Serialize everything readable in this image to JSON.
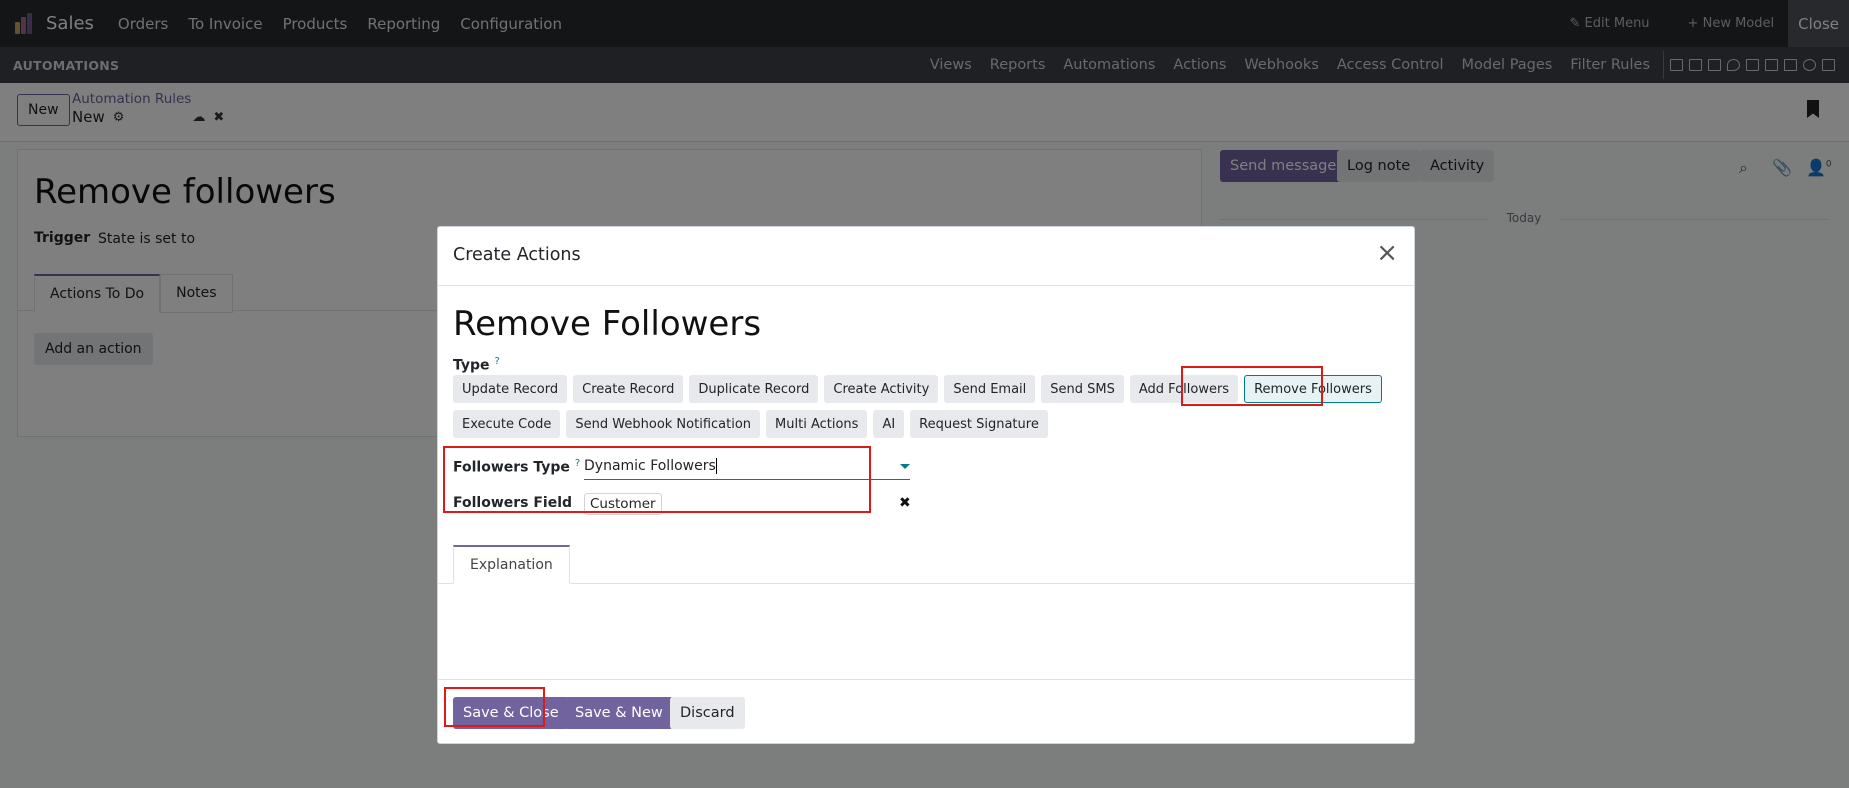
{
  "topbar": {
    "app_name": "Sales",
    "menu": [
      "Orders",
      "To Invoice",
      "Products",
      "Reporting",
      "Configuration"
    ],
    "edit_menu": "Edit Menu",
    "new_model": "New Model",
    "close": "Close"
  },
  "subbar": {
    "brand": "AUTOMATIONS",
    "items": [
      "Views",
      "Reports",
      "Automations",
      "Actions",
      "Webhooks",
      "Access Control",
      "Model Pages",
      "Filter Rules"
    ]
  },
  "control": {
    "new_button": "New",
    "breadcrumb": "Automation Rules",
    "record_name": "New"
  },
  "form": {
    "title": "Remove followers",
    "trigger_label": "Trigger",
    "trigger_value": "State is set to",
    "tabs": [
      "Actions To Do",
      "Notes"
    ],
    "add_action": "Add an action"
  },
  "chatter": {
    "send_message": "Send message",
    "log_note": "Log note",
    "activity": "Activity",
    "today": "Today",
    "follower_count": "0"
  },
  "modal": {
    "title": "Create Actions",
    "name": "Remove Followers",
    "type_label": "Type",
    "type_help": "?",
    "types_row1": [
      "Update Record",
      "Create Record",
      "Duplicate Record",
      "Create Activity",
      "Send Email",
      "Send SMS",
      "Add Followers",
      "Remove Followers"
    ],
    "types_row2": [
      "Execute Code",
      "Send Webhook Notification",
      "Multi Actions",
      "AI",
      "Request Signature"
    ],
    "selected_type": "Remove Followers",
    "followers_type_label": "Followers Type",
    "followers_type_help": "?",
    "followers_type_value": "Dynamic Followers",
    "followers_field_label": "Followers Field",
    "followers_field_value": "Customer",
    "explanation_tab": "Explanation",
    "save_close": "Save & Close",
    "save_new": "Save & New",
    "discard": "Discard"
  },
  "colors": {
    "primary": "#71639e",
    "accent": "#017e84",
    "highlight": "#dc1a1a"
  }
}
